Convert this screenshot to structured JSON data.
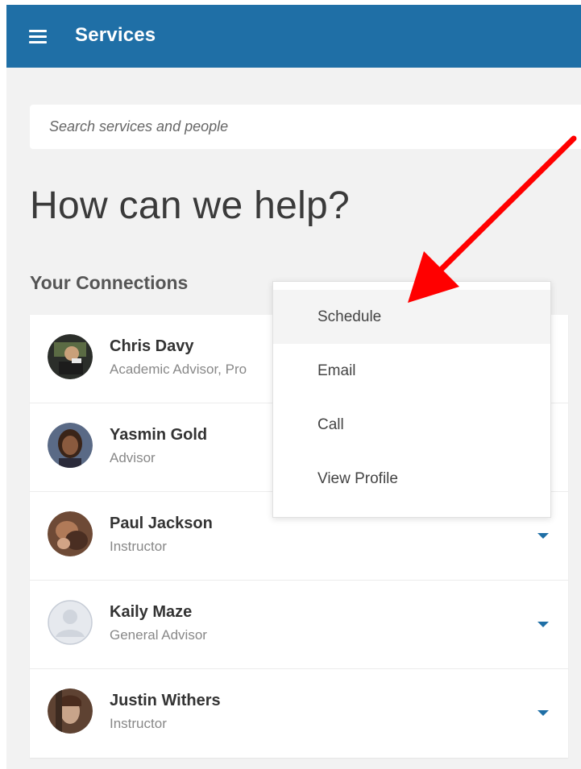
{
  "header": {
    "title": "Services",
    "menu_icon": "hamburger-menu-icon"
  },
  "search": {
    "placeholder": "Search services and people",
    "value": ""
  },
  "headline": "How can we help?",
  "connections": {
    "label": "Your Connections",
    "people": [
      {
        "name": "Chris Davy",
        "role": "Academic Advisor, Pro",
        "avatar": "photo"
      },
      {
        "name": "Yasmin Gold",
        "role": "Advisor",
        "avatar": "photo"
      },
      {
        "name": "Paul Jackson",
        "role": "Instructor",
        "avatar": "photo"
      },
      {
        "name": "Kaily Maze",
        "role": "General Advisor",
        "avatar": "placeholder-user-icon"
      },
      {
        "name": "Justin Withers",
        "role": "Instructor",
        "avatar": "photo"
      }
    ]
  },
  "dropdown": {
    "items": [
      "Schedule",
      "Email",
      "Call",
      "View Profile"
    ],
    "highlighted_index": 0
  },
  "colors": {
    "header": "#1f6fa6",
    "background": "#f2f2f2",
    "chevron": "#1f6fa6",
    "annotation_arrow": "#ff0000"
  }
}
